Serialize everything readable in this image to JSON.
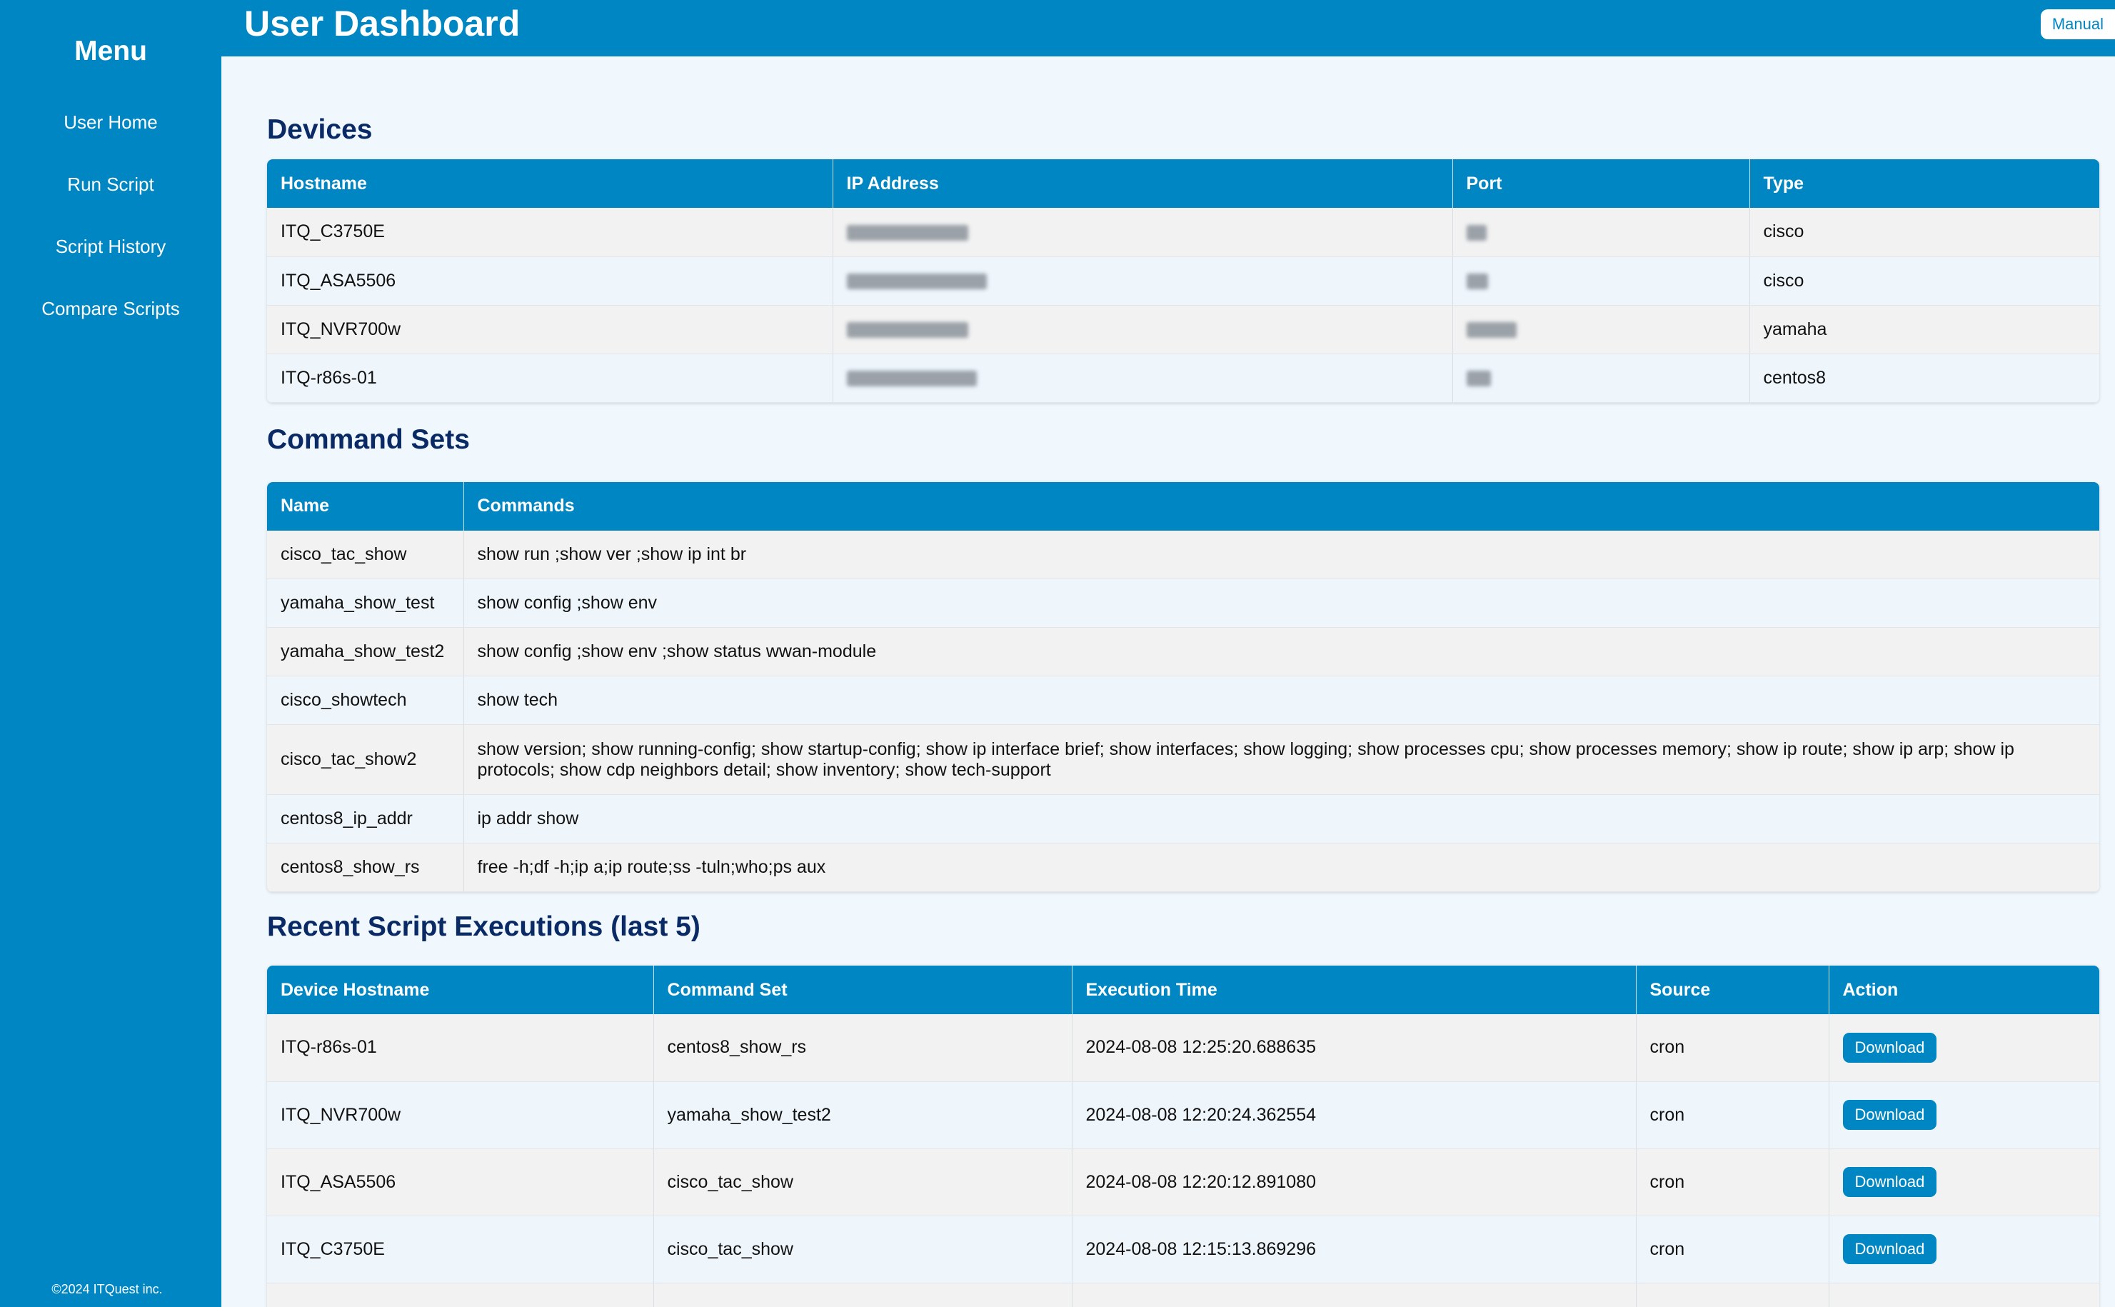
{
  "sidebar": {
    "menu_title": "Menu",
    "items": [
      {
        "label": "User Home"
      },
      {
        "label": "Run Script"
      },
      {
        "label": "Script History"
      },
      {
        "label": "Compare Scripts"
      }
    ],
    "footer": "©2024 ITQuest inc."
  },
  "header": {
    "title": "User Dashboard",
    "manual_label": "Manual"
  },
  "devices": {
    "title": "Devices",
    "columns": [
      "Hostname",
      "IP Address",
      "Port",
      "Type"
    ],
    "rows": [
      {
        "hostname": "ITQ_C3750E",
        "ip": "[redacted]",
        "port": "[redacted]",
        "type": "cisco"
      },
      {
        "hostname": "ITQ_ASA5506",
        "ip": "[redacted]",
        "port": "[redacted]",
        "type": "cisco"
      },
      {
        "hostname": "ITQ_NVR700w",
        "ip": "[redacted]",
        "port": "[redacted]",
        "type": "yamaha"
      },
      {
        "hostname": "ITQ-r86s-01",
        "ip": "[redacted]",
        "port": "[redacted]",
        "type": "centos8"
      }
    ]
  },
  "command_sets": {
    "title": "Command Sets",
    "columns": [
      "Name",
      "Commands"
    ],
    "rows": [
      {
        "name": "cisco_tac_show",
        "commands": "show run ;show ver ;show ip int br"
      },
      {
        "name": "yamaha_show_test",
        "commands": "show config ;show env"
      },
      {
        "name": "yamaha_show_test2",
        "commands": "show config ;show env ;show status wwan-module"
      },
      {
        "name": "cisco_showtech",
        "commands": "show tech"
      },
      {
        "name": "cisco_tac_show2",
        "commands": "show version; show running-config; show startup-config; show ip interface brief; show interfaces; show logging; show processes cpu; show processes memory; show ip route; show ip arp; show ip protocols; show cdp neighbors detail; show inventory; show tech-support"
      },
      {
        "name": "centos8_ip_addr",
        "commands": "ip addr show"
      },
      {
        "name": "centos8_show_rs",
        "commands": "free -h;df -h;ip a;ip route;ss -tuln;who;ps aux"
      }
    ]
  },
  "executions": {
    "title": "Recent Script Executions (last 5)",
    "columns": [
      "Device Hostname",
      "Command Set",
      "Execution Time",
      "Source",
      "Action"
    ],
    "action_label": "Download",
    "rows": [
      {
        "device": "ITQ-r86s-01",
        "command_set": "centos8_show_rs",
        "time": "2024-08-08 12:25:20.688635",
        "source": "cron"
      },
      {
        "device": "ITQ_NVR700w",
        "command_set": "yamaha_show_test2",
        "time": "2024-08-08 12:20:24.362554",
        "source": "cron"
      },
      {
        "device": "ITQ_ASA5506",
        "command_set": "cisco_tac_show",
        "time": "2024-08-08 12:20:12.891080",
        "source": "cron"
      },
      {
        "device": "ITQ_C3750E",
        "command_set": "cisco_tac_show",
        "time": "2024-08-08 12:15:13.869296",
        "source": "cron"
      }
    ]
  },
  "colors": {
    "primary": "#0086c3",
    "heading": "#0a2a66",
    "background": "#f0f7fd"
  }
}
